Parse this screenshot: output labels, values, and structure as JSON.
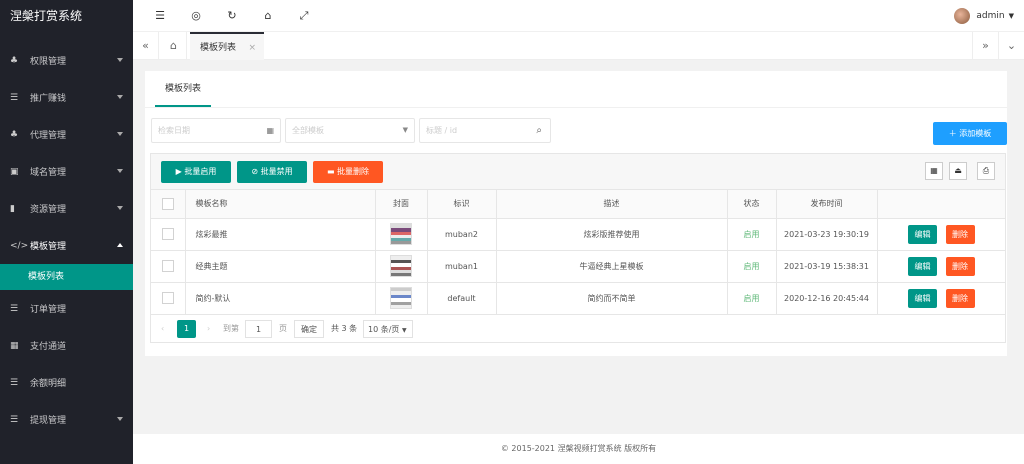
{
  "app": {
    "title": "涅槃打赏系统"
  },
  "menu": [
    {
      "label": "权限管理",
      "icon": "user-group-icon"
    },
    {
      "label": "推广赚钱",
      "icon": "list-icon"
    },
    {
      "label": "代理管理",
      "icon": "sitemap-icon"
    },
    {
      "label": "域名管理",
      "icon": "calendar-icon"
    },
    {
      "label": "资源管理",
      "icon": "book-icon"
    },
    {
      "label": "模板管理",
      "icon": "code-icon"
    },
    {
      "label": "订单管理",
      "icon": "list-icon"
    },
    {
      "label": "支付通道",
      "icon": "qrcode-icon"
    },
    {
      "label": "余额明细",
      "icon": "list-icon"
    },
    {
      "label": "提现管理",
      "icon": "list-icon"
    }
  ],
  "submenu": {
    "label": "模板列表"
  },
  "header": {
    "user": "admin"
  },
  "tabs": {
    "active": "模板列表"
  },
  "card": {
    "title": "模板列表"
  },
  "filters": {
    "date_placeholder": "检索日期",
    "select_placeholder": "全部模板",
    "search_placeholder": "标题 / id"
  },
  "buttons": {
    "add": "添加模板",
    "batch_enable": "批量启用",
    "batch_disable": "批量禁用",
    "batch_delete": "批量删除",
    "edit": "编辑",
    "delete": "删除"
  },
  "table": {
    "headers": [
      "模板名称",
      "封面",
      "标识",
      "描述",
      "状态",
      "发布时间"
    ],
    "rows": [
      {
        "name": "炫彩最推",
        "code": "muban2",
        "desc": "炫彩版推荐使用",
        "status": "启用",
        "time": "2021-03-23 19:30:19"
      },
      {
        "name": "经典主题",
        "code": "muban1",
        "desc": "牛逼经典上星模板",
        "status": "启用",
        "time": "2021-03-19 15:38:31"
      },
      {
        "name": "简约-默认",
        "code": "default",
        "desc": "简约而不简单",
        "status": "启用",
        "time": "2020-12-16 20:45:44"
      }
    ]
  },
  "pager": {
    "current": "1",
    "goto_label": "到第",
    "goto_value": "1",
    "page_unit": "页",
    "confirm": "确定",
    "total": "共 3 条",
    "page_size": "10 条/页"
  },
  "footer": {
    "text": "© 2015-2021 涅槃视频打赏系统 版权所有"
  },
  "colors": {
    "primary": "#009688",
    "blue": "#1e9fff",
    "danger": "#ff5722",
    "sidebar": "#20222a"
  }
}
